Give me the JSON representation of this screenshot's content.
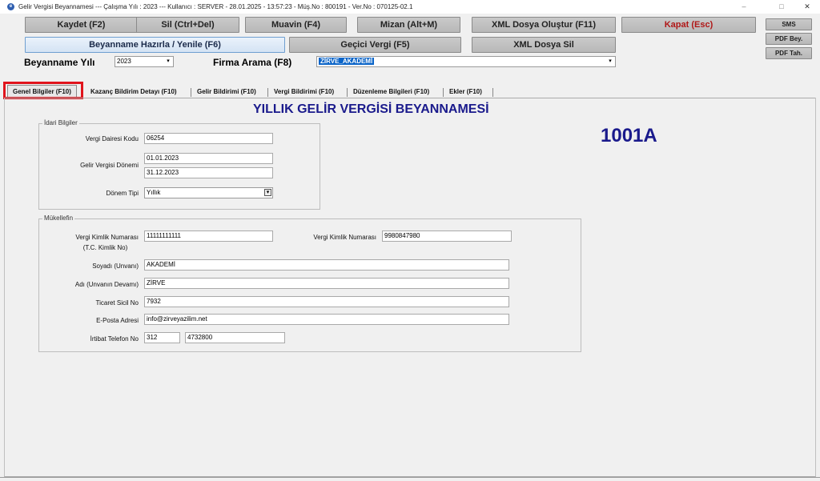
{
  "window": {
    "title": "Gelir Vergisi Beyannamesi  ---  Çalışma Yılı : 2023  ---  Kullanıcı : SERVER - 28.01.2025 - 13:57:23 - Müş.No : 800191 - Ver.No : 070125-02.1",
    "minimize": "–",
    "maximize": "□",
    "close": "✕"
  },
  "toolbar": {
    "save": "Kaydet (F2)",
    "delete": "Sil (Ctrl+Del)",
    "muavin": "Muavin (F4)",
    "mizan": "Mizan (Alt+M)",
    "xml_create": "XML Dosya Oluştur (F11)",
    "close": "Kapat (Esc)",
    "prepare": "Beyanname Hazırla / Yenile (F6)",
    "temp_tax": "Geçici Vergi (F5)",
    "xml_delete": "XML Dosya Sil",
    "sms": "SMS",
    "pdf_bey": "PDF Bey.",
    "pdf_tah": "PDF Tah."
  },
  "filters": {
    "year_label": "Beyanname Yılı",
    "year_value": "2023",
    "company_label": "Firma Arama (F8)",
    "company_value": "ZİRVE_AKADEMİ"
  },
  "tabs": [
    {
      "label": "Genel Bilgiler (F10)",
      "active": true
    },
    {
      "label": "Kazanç Bildirim Detayı (F10)"
    },
    {
      "label": "Gelir Bildirimi (F10)"
    },
    {
      "label": "Vergi Bildirimi (F10)"
    },
    {
      "label": "Düzenleme Bilgileri (F10)"
    },
    {
      "label": "Ekler (F10)"
    }
  ],
  "page": {
    "title": "YILLIK GELİR VERGİSİ BEYANNAMESİ",
    "form_code": "1001A"
  },
  "idari": {
    "title": "İdari Bilgiler",
    "tax_office_label": "Vergi Dairesi Kodu",
    "tax_office_value": "06254",
    "period_label": "Gelir Vergisi Dönemi",
    "period_start": "01.01.2023",
    "period_end": "31.12.2023",
    "period_type_label": "Dönem Tipi",
    "period_type_value": "Yıllık"
  },
  "mukellef": {
    "title": "Mükellefin",
    "tckn_label_1": "Vergi Kimlik Numarası",
    "tckn_label_2": "(T.C. Kimlik No)",
    "tckn_value": "11111111111",
    "vkn_label": "Vergi Kimlik Numarası",
    "vkn_value": "9980847980",
    "surname_label": "Soyadı (Unvanı)",
    "surname_value": "AKADEMİ",
    "name_label": "Adı (Unvanın Devamı)",
    "name_value": "ZİRVE",
    "trade_reg_label": "Ticaret Sicil No",
    "trade_reg_value": "7932",
    "email_label": "E-Posta Adresi",
    "email_value": "info@zirveyazilim.net",
    "phone_label": "İrtibat Telefon No",
    "phone_area": "312",
    "phone_number": "4732800"
  },
  "colors": {
    "title_blue": "#1a1a8c",
    "highlight_red": "#e0141c",
    "selection_blue": "#0a64c8"
  }
}
